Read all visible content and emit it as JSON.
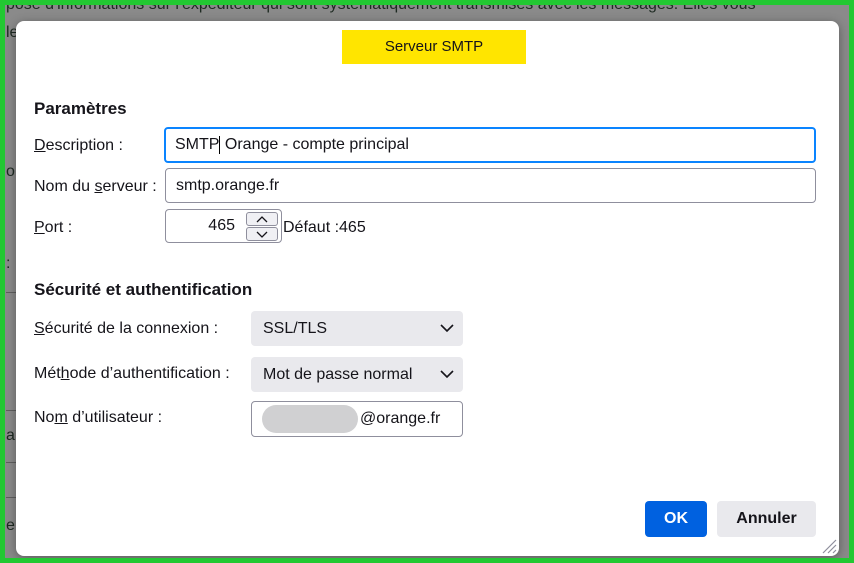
{
  "background": {
    "line1": "pose d'informations sur l'expéditeur qui sont systématiquement transmises avec les messages. Elles vous",
    "line2": "le",
    "line3": "o",
    "line4": ":",
    "line5": "a",
    "line6": "e"
  },
  "dialog": {
    "title": "Serveur SMTP",
    "parametres": {
      "heading": "Paramètres",
      "description_label_key": "D",
      "description_label_rest": "escription :",
      "description_value_before_caret": "SMTP",
      "description_value_after_caret": " Orange - compte principal",
      "server_label_before": "Nom du ",
      "server_label_key": "s",
      "server_label_after": "erveur :",
      "server_value": "smtp.orange.fr",
      "port_label_key": "P",
      "port_label_rest": "ort :",
      "port_value": "465",
      "port_default": "Défaut :465"
    },
    "security": {
      "heading": "Sécurité et authentification",
      "connection_label_key": "S",
      "connection_label_rest": "écurité de la connexion :",
      "connection_value": "SSL/TLS",
      "auth_label_before": "Mét",
      "auth_label_key": "h",
      "auth_label_after": "ode d’authentification :",
      "auth_value": "Mot de passe normal",
      "username_label_before": "No",
      "username_label_key": "m",
      "username_label_after": " d’utilisateur :",
      "username_visible_suffix": "@orange.fr"
    },
    "buttons": {
      "ok": "OK",
      "cancel": "Annuler"
    }
  },
  "colors": {
    "title_highlight": "#ffe500",
    "focus_border": "#0a84ff",
    "primary_button": "#0061e0",
    "frame": "#22c832"
  }
}
